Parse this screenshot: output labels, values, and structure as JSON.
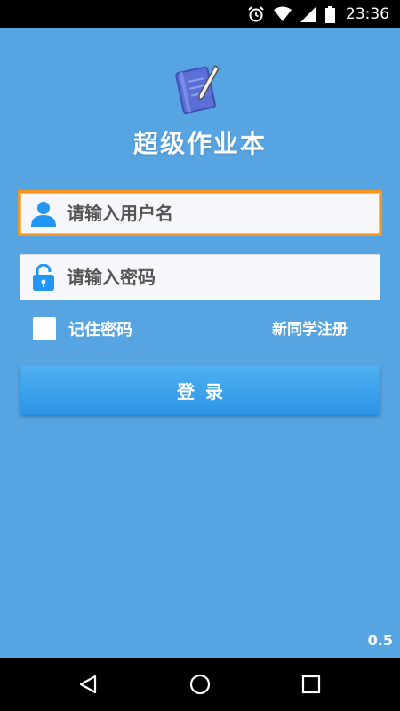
{
  "status_bar": {
    "time": "23:36",
    "icons": [
      "alarm-icon",
      "wifi-icon",
      "signal-icon",
      "battery-icon"
    ]
  },
  "app": {
    "title": "超级作业本",
    "logo_icon": "notebook-pen-icon",
    "version": "0.5"
  },
  "login_form": {
    "username_placeholder": "请输入用户名",
    "username_value": "",
    "username_icon": "user-icon",
    "password_placeholder": "请输入密码",
    "password_value": "",
    "password_icon": "lock-icon",
    "remember_label": "记住密码",
    "remember_checked": false,
    "register_label": "新同学注册",
    "login_label": "登录"
  },
  "nav_bar": {
    "buttons": [
      "back-icon",
      "home-icon",
      "recents-icon"
    ]
  },
  "colors": {
    "background": "#57a4e2",
    "focus_border": "#f2961f",
    "button": "#3ba3ec",
    "icon_blue": "#2196f3"
  }
}
